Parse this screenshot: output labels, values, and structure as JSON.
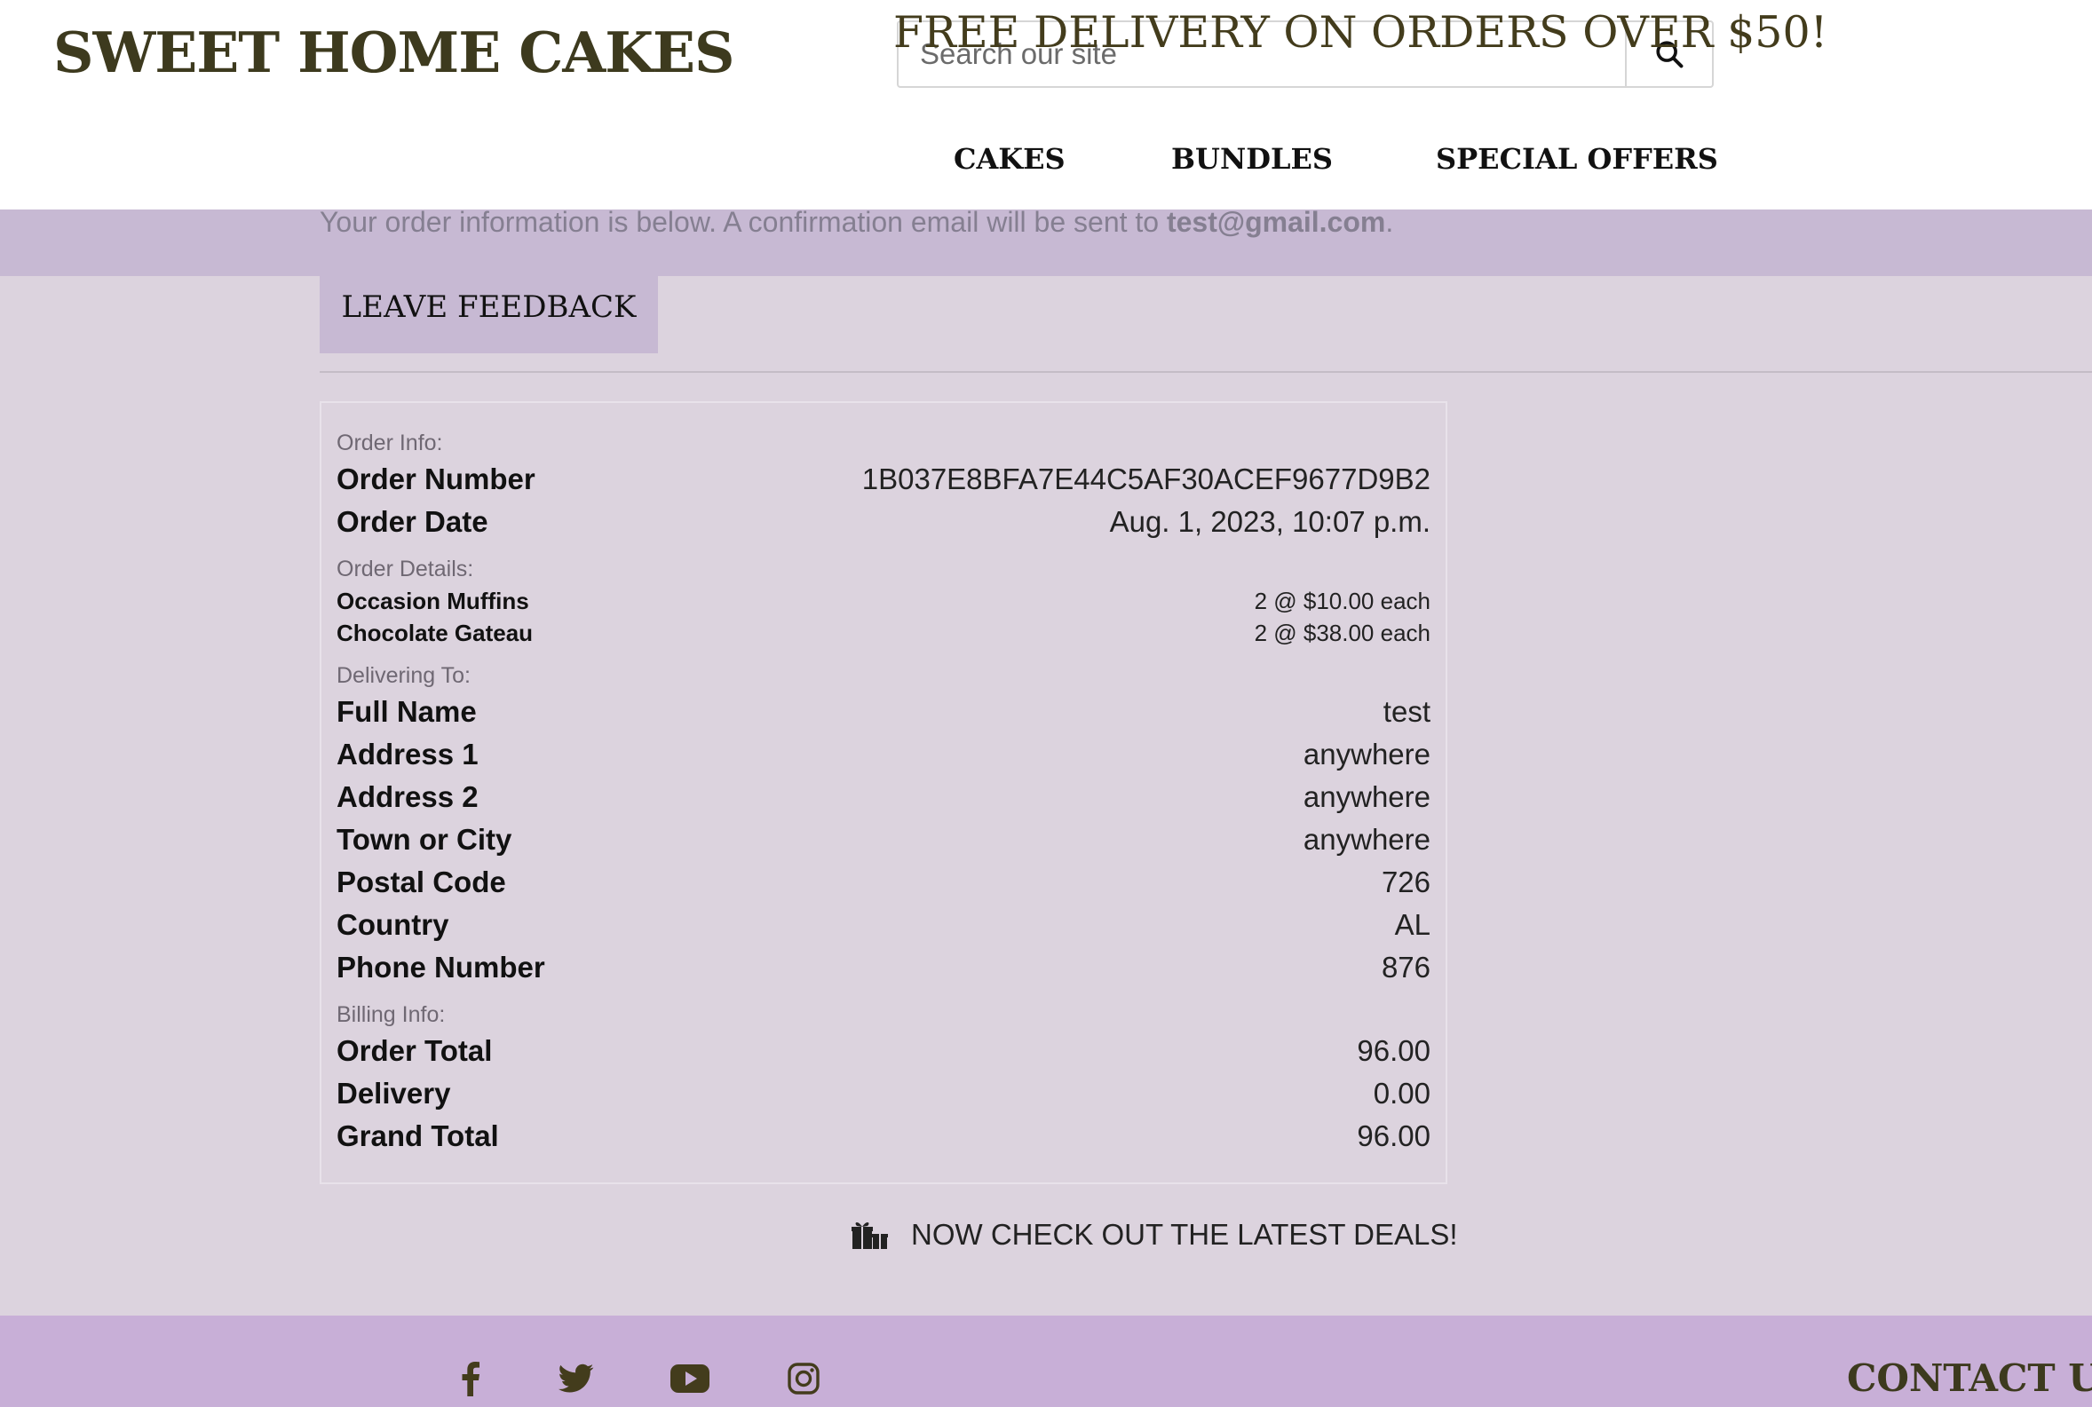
{
  "header": {
    "brand": "SWEET HOME CAKES",
    "search_placeholder": "Search our site",
    "nav": [
      "CAKES",
      "BUNDLES",
      "SPECIAL OFFERS"
    ]
  },
  "banner": {
    "text": "FREE DELIVERY ON ORDERS OVER $50!"
  },
  "confirmation": {
    "text": "Your order information is below. A confirmation email will be sent to",
    "email": "test@gmail.com",
    "end": "."
  },
  "feedback_button": "LEAVE FEEDBACK",
  "order": {
    "order_info_label": "Order Info:",
    "order_info": [
      {
        "label": "Order Number",
        "value": "1B037E8BFA7E44C5AF30ACEF9677D9B2"
      },
      {
        "label": "Order Date",
        "value": "Aug. 1, 2023, 10:07 p.m."
      }
    ],
    "details_label": "Order Details:",
    "items": [
      {
        "name": "Occasion Muffins",
        "qty_price": "2 @ $10.00 each"
      },
      {
        "name": "Chocolate Gateau",
        "qty_price": "2 @ $38.00 each"
      }
    ],
    "delivering_label": "Delivering To:",
    "delivering": [
      {
        "label": "Full Name",
        "value": "test"
      },
      {
        "label": "Address 1",
        "value": "anywhere"
      },
      {
        "label": "Address 2",
        "value": "anywhere"
      },
      {
        "label": "Town or City",
        "value": "anywhere"
      },
      {
        "label": "Postal Code",
        "value": "726"
      },
      {
        "label": "Country",
        "value": "AL"
      },
      {
        "label": "Phone Number",
        "value": "876"
      }
    ],
    "billing_label": "Billing Info:",
    "billing": [
      {
        "label": "Order Total",
        "value": "96.00"
      },
      {
        "label": "Delivery",
        "value": "0.00"
      },
      {
        "label": "Grand Total",
        "value": "96.00"
      }
    ]
  },
  "deals_link": "NOW CHECK OUT THE LATEST DEALS!",
  "footer": {
    "social_icons": [
      "facebook-icon",
      "twitter-icon",
      "youtube-icon",
      "instagram-icon"
    ],
    "contact_heading": "CONTACT US"
  },
  "colors": {
    "brand_olive": "#3d3a1e",
    "banner_bg": "#c7b9d3",
    "page_bg": "#dcd3de",
    "footer_bg": "#c8afd7"
  }
}
